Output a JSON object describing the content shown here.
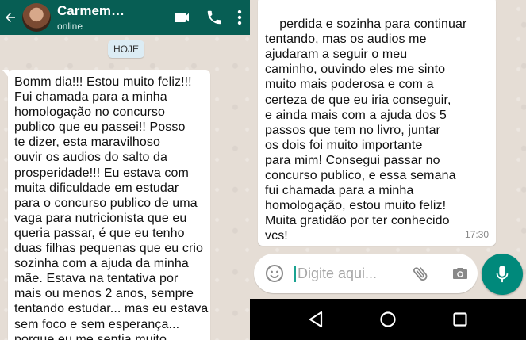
{
  "header": {
    "contact_name": "Carmem…",
    "contact_status": "online"
  },
  "chat": {
    "date_chip": "HOJE",
    "message_left_text": "Bomm dia!!! Estou muito feliz!!!\nFui chamada para a minha\nhomologação no concurso\npublico que eu passei!! Posso\nte dizer, esta maravilhoso\nouvir os audios do salto da\nprosperidade!!! Eu estava com\nmuita dificuldade em estudar\npara o concurso publico de uma\nvaga para nutricionista que eu\nqueria passar, é que eu tenho\nduas filhas pequenas que eu crio\nsozinha com a ajuda da minha\nmãe. Estava na tentativa por\nmais ou menos 2 anos, sempre\ntentando estudar... mas eu estava\nsem foco e sem esperança...\nporque eu me sentia muito",
    "message_right_text": "perdida e sozinha para continuar\ntentando, mas os audios me\najudaram a seguir o meu\ncaminho, ouvindo eles me sinto\nmuito mais poderosa e com a\ncerteza de que eu iria conseguir,\ne ainda mais com a ajuda dos 5\npassos que tem no livro, juntar\nos dois foi muito importante\npara mim! Consegui passar no\nconcurso publico, e essa semana\nfui chamada para a minha\nhomologação, estou muito feliz!\nMuita gratidão por ter conhecido\nvcs!",
    "message_right_time": "17:30"
  },
  "composer": {
    "placeholder": "Digite aqui...",
    "value": ""
  },
  "colors": {
    "header": "#075e54",
    "accent": "#00897b",
    "wallpaper": "#e5ddd5",
    "bubble": "#ffffff"
  },
  "icons": {
    "back": "arrow-left-icon",
    "video": "video-camera-icon",
    "call": "phone-icon",
    "menu": "more-vert-icon",
    "emoji": "emoji-icon",
    "attach": "paperclip-icon",
    "camera": "camera-icon",
    "mic": "microphone-icon",
    "nav_back": "nav-back-triangle-icon",
    "nav_home": "nav-home-circle-icon",
    "nav_recent": "nav-recents-square-icon"
  }
}
